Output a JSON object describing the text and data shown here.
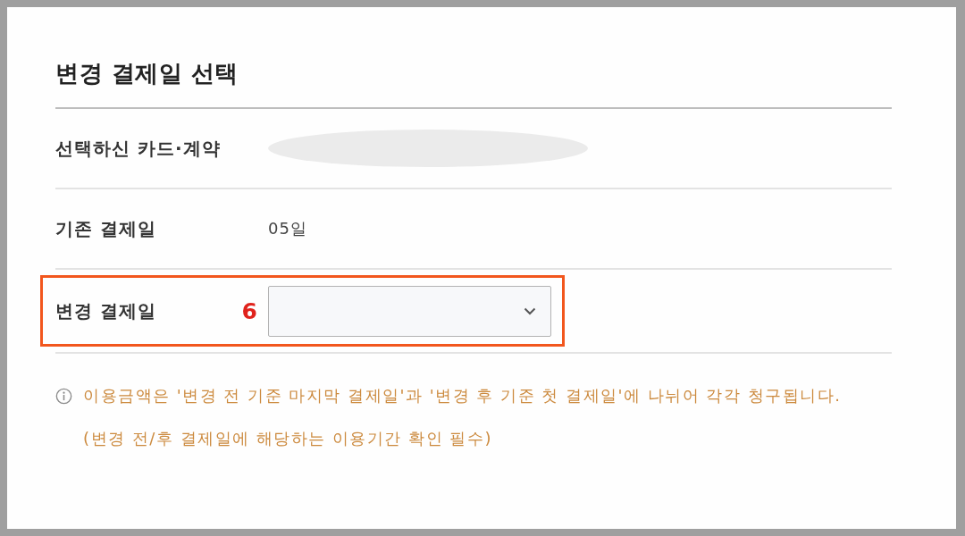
{
  "title": "변경 결제일 선택",
  "rows": [
    {
      "kind": "redacted",
      "label": "선택하신 카드·계약",
      "highlighted": false
    },
    {
      "kind": "text",
      "label": "기존 결제일",
      "value": "05일",
      "highlighted": false
    },
    {
      "kind": "select",
      "label": "변경 결제일",
      "step": "6",
      "highlighted": true
    }
  ],
  "notice": {
    "lines": [
      "이용금액은 '변경 전 기준 마지막 결제일'과 '변경 후 기준 첫 결제일'에 나뉘어 각각 청구됩니다.",
      "(변경 전/후 결제일에 해당하는 이용기간 확인 필수)"
    ]
  }
}
